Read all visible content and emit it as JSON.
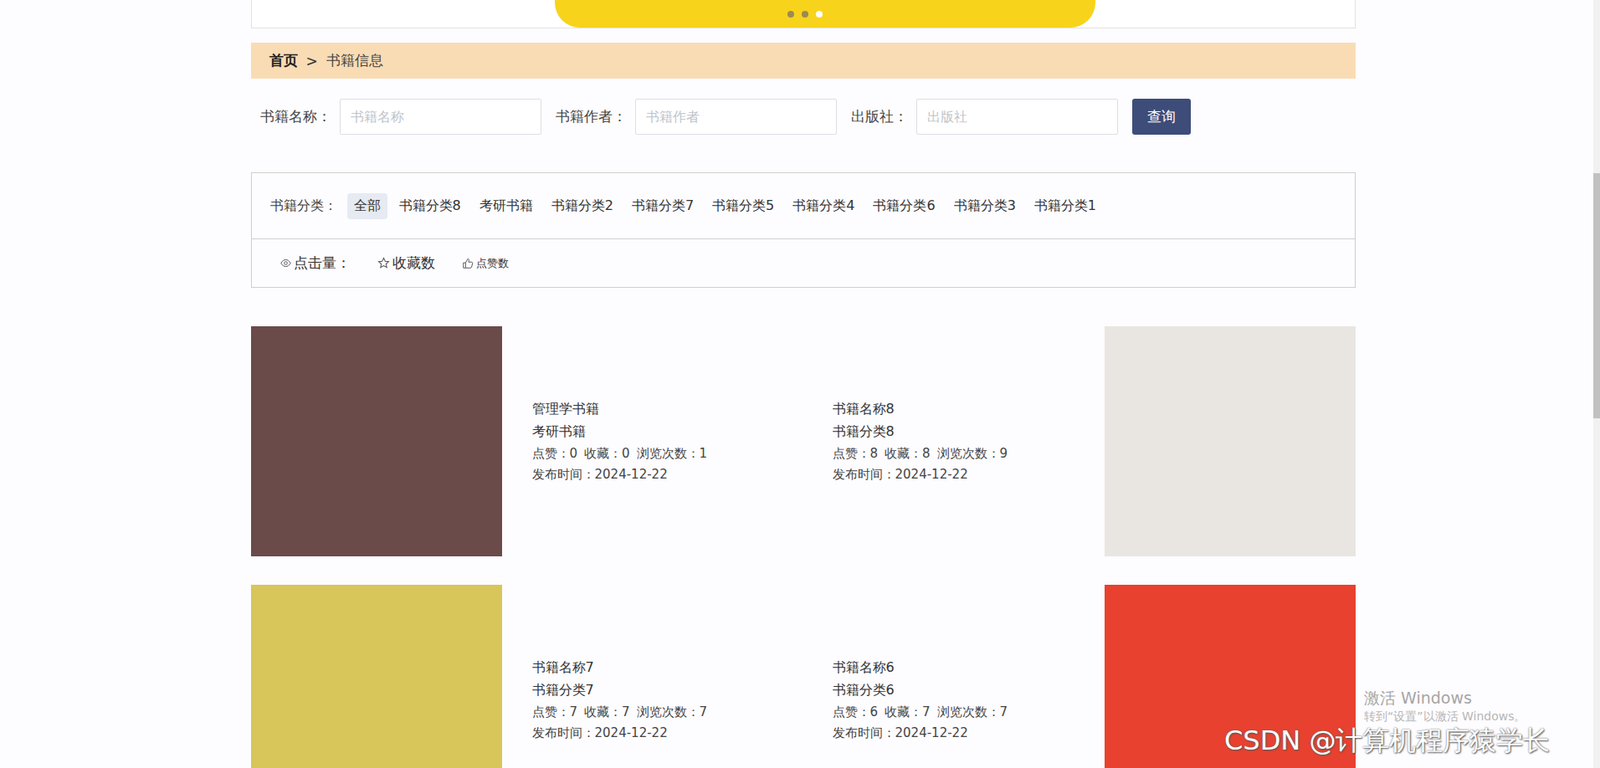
{
  "banner": {
    "dots": [
      {
        "selected": false
      },
      {
        "selected": false
      },
      {
        "selected": true
      }
    ]
  },
  "breadcrumb": {
    "home": "首页",
    "separator": ">",
    "current": "书籍信息"
  },
  "search": {
    "fields": [
      {
        "label": "书籍名称：",
        "placeholder": "书籍名称"
      },
      {
        "label": "书籍作者：",
        "placeholder": "书籍作者"
      },
      {
        "label": "出版社：",
        "placeholder": "出版社"
      }
    ],
    "button": "查询"
  },
  "categories": {
    "label": "书籍分类：",
    "items": [
      {
        "label": "全部",
        "selected": true
      },
      {
        "label": "书籍分类8",
        "selected": false
      },
      {
        "label": "考研书籍",
        "selected": false
      },
      {
        "label": "书籍分类2",
        "selected": false
      },
      {
        "label": "书籍分类7",
        "selected": false
      },
      {
        "label": "书籍分类5",
        "selected": false
      },
      {
        "label": "书籍分类4",
        "selected": false
      },
      {
        "label": "书籍分类6",
        "selected": false
      },
      {
        "label": "书籍分类3",
        "selected": false
      },
      {
        "label": "书籍分类1",
        "selected": false
      }
    ]
  },
  "sort": {
    "views": "点击量：",
    "favorites": "收藏数",
    "likes": "点赞数"
  },
  "books": [
    {
      "name": "管理学书籍",
      "category": "考研书籍",
      "likes": "点赞：0",
      "favorites": "收藏：0",
      "views": "浏览次数：1",
      "date": "发布时间：2024-12-22"
    },
    {
      "name": "书籍名称8",
      "category": "书籍分类8",
      "likes": "点赞：8",
      "favorites": "收藏：8",
      "views": "浏览次数：9",
      "date": "发布时间：2024-12-22"
    },
    {
      "name": "书籍名称7",
      "category": "书籍分类7",
      "likes": "点赞：7",
      "favorites": "收藏：7",
      "views": "浏览次数：7",
      "date": "发布时间：2024-12-22"
    },
    {
      "name": "书籍名称6",
      "category": "书籍分类6",
      "likes": "点赞：6",
      "favorites": "收藏：7",
      "views": "浏览次数：7",
      "date": "发布时间：2024-12-22"
    }
  ],
  "watermark": {
    "activate_title": "激活 Windows",
    "activate_hint": "转到“设置”以激活 Windows。",
    "csdn": "CSDN @计算机程序猿学长"
  }
}
